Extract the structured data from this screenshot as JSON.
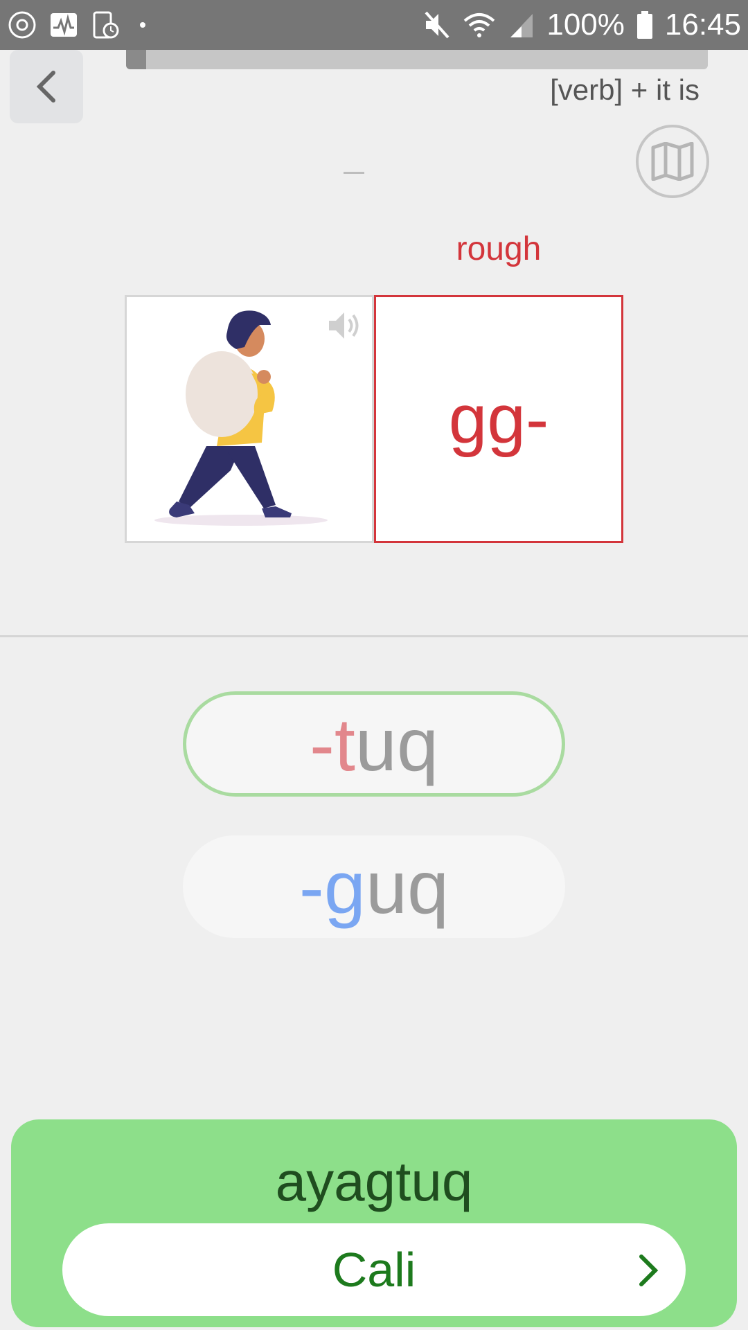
{
  "status_bar": {
    "battery_text": "100%",
    "time": "16:45"
  },
  "header": {
    "progress_fraction": 0.035,
    "grammar_hint": "[verb] + it is"
  },
  "card": {
    "gloss": "rough",
    "stem": "gg-"
  },
  "options": [
    {
      "prefix": "-",
      "highlight": "t",
      "rest": "uq",
      "state": "selected-correct"
    },
    {
      "prefix": "-",
      "highlight": "g",
      "rest": "uq",
      "state": "default"
    }
  ],
  "result": {
    "answer": "ayagtuq",
    "continue_label": "Cali"
  },
  "colors": {
    "accent_red": "#d3353b",
    "success_green": "#8ddf8a",
    "correct_border": "#a9dba0",
    "highlight_blue": "#7aa6f2"
  },
  "icons": [
    "back-chevron-icon",
    "map-icon",
    "speaker-icon",
    "chevron-right-icon"
  ]
}
